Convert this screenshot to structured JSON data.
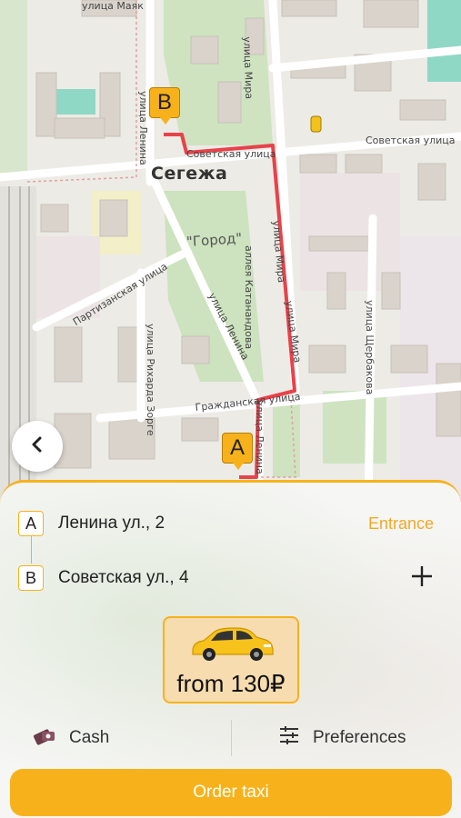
{
  "map": {
    "city_label": "Сегежа",
    "district_label": "\"Город\"",
    "streets": {
      "sovetskaya_right": "Советская улица",
      "sovetskaya_left": "Советская улица",
      "mira_top": "улица Мира",
      "mira_mid": "улица Мира",
      "mira_low": "улица Мира",
      "lenina_top": "улица Ленина",
      "lenina_mid": "улица Ленина",
      "lenina_low": "улица Ленина",
      "katanandova": "аллея Катанандова",
      "partizanskaya": "Партизанская улица",
      "zorge": "улица Рихарда Зорге",
      "grazhdanskaya": "Гражданская улица",
      "sherbakova": "улица Щербакова",
      "mayakovskogo": "улица Маяк"
    },
    "marker_a": "A",
    "marker_b": "B",
    "route_color": "#e8424a"
  },
  "back_button": {
    "icon": "chevron-left-icon"
  },
  "route": {
    "from": {
      "label": "A",
      "address": "Ленина ул., 2",
      "action": "Entrance"
    },
    "to": {
      "label": "B",
      "address": "Советская ул., 4",
      "action_icon": "plus-icon"
    }
  },
  "tariff": {
    "price": "from 130₽",
    "icon": "car-icon"
  },
  "options": {
    "payment": {
      "label": "Cash",
      "icon": "cash-icon"
    },
    "preferences": {
      "label": "Preferences",
      "icon": "sliders-icon"
    }
  },
  "order_button": {
    "label": "Order taxi"
  },
  "colors": {
    "accent": "#f7b21b",
    "entrance": "#f3a925",
    "card": "#f6dcaf"
  }
}
